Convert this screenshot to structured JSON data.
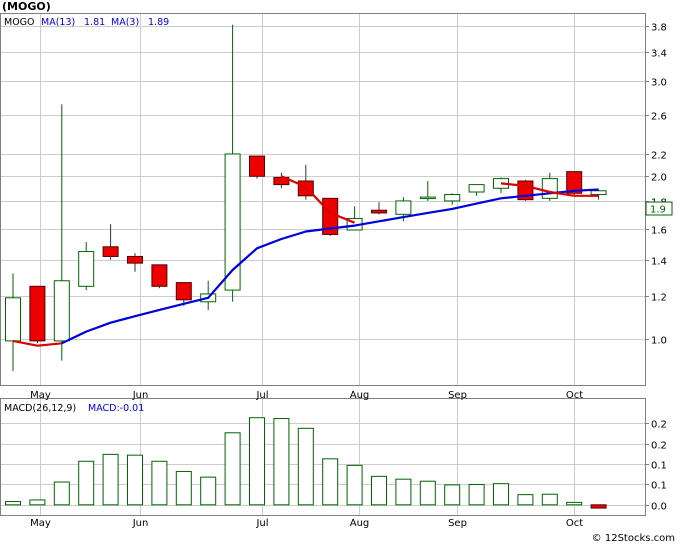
{
  "title": "(MOGO)",
  "legend": {
    "symbol": "MOGO",
    "ma13_label": "MA(13)",
    "ma13_value": "1.81",
    "ma3_label": "MA(3)",
    "ma3_value": "1.89"
  },
  "price_tag": "1.9",
  "macd_legend": {
    "label": "MACD(26,12,9)",
    "value_label": "MACD:-0.01"
  },
  "footer": "© 12Stocks.com",
  "colors": {
    "up_body": "#ffffff",
    "up_border": "#006400",
    "down_body": "#ee0000",
    "ma13": "#0000dd",
    "ma3": "#dd0000",
    "grid": "#cccccc",
    "frame": "#808080",
    "macd_bar": "#006400"
  },
  "chart_data": [
    {
      "type": "candlestick",
      "title": "(MOGO)",
      "scale": "log",
      "ylim": [
        0.82,
        4.0
      ],
      "yticks": [
        "1.0",
        "1.2",
        "1.4",
        "1.6",
        "1.8",
        "2.0",
        "2.2",
        "2.6",
        "3.0",
        "3.4",
        "3.8"
      ],
      "ytick_values": [
        1.0,
        1.2,
        1.4,
        1.6,
        1.8,
        2.0,
        2.2,
        2.6,
        3.0,
        3.4,
        3.8
      ],
      "x_labels": [
        {
          "label": "May",
          "index": 1.1
        },
        {
          "label": "Jun",
          "index": 5.2
        },
        {
          "label": "Jul",
          "index": 10.2
        },
        {
          "label": "Aug",
          "index": 14.2
        },
        {
          "label": "Sep",
          "index": 18.2
        },
        {
          "label": "Oct",
          "index": 23.0
        }
      ],
      "candles": [
        {
          "o": 0.99,
          "h": 1.32,
          "l": 0.87,
          "c": 1.19
        },
        {
          "o": 1.25,
          "h": 1.25,
          "l": 0.98,
          "c": 0.99
        },
        {
          "o": 0.99,
          "h": 2.72,
          "l": 0.91,
          "c": 1.28
        },
        {
          "o": 1.25,
          "h": 1.51,
          "l": 1.23,
          "c": 1.45
        },
        {
          "o": 1.48,
          "h": 1.63,
          "l": 1.4,
          "c": 1.42
        },
        {
          "o": 1.42,
          "h": 1.44,
          "l": 1.33,
          "c": 1.38
        },
        {
          "o": 1.37,
          "h": 1.37,
          "l": 1.24,
          "c": 1.25
        },
        {
          "o": 1.27,
          "h": 1.27,
          "l": 1.15,
          "c": 1.18
        },
        {
          "o": 1.17,
          "h": 1.28,
          "l": 1.13,
          "c": 1.21
        },
        {
          "o": 1.23,
          "h": 3.82,
          "l": 1.17,
          "c": 2.2
        },
        {
          "o": 2.18,
          "h": 2.18,
          "l": 1.98,
          "c": 2.0
        },
        {
          "o": 1.99,
          "h": 2.03,
          "l": 1.9,
          "c": 1.93
        },
        {
          "o": 1.96,
          "h": 2.1,
          "l": 1.81,
          "c": 1.84
        },
        {
          "o": 1.82,
          "h": 1.82,
          "l": 1.55,
          "c": 1.56
        },
        {
          "o": 1.59,
          "h": 1.76,
          "l": 1.59,
          "c": 1.67
        },
        {
          "o": 1.73,
          "h": 1.79,
          "l": 1.7,
          "c": 1.71
        },
        {
          "o": 1.7,
          "h": 1.83,
          "l": 1.65,
          "c": 1.8
        },
        {
          "o": 1.83,
          "h": 1.96,
          "l": 1.8,
          "c": 1.83
        },
        {
          "o": 1.8,
          "h": 1.86,
          "l": 1.77,
          "c": 1.85
        },
        {
          "o": 1.87,
          "h": 1.93,
          "l": 1.84,
          "c": 1.93
        },
        {
          "o": 1.9,
          "h": 1.99,
          "l": 1.86,
          "c": 1.98
        },
        {
          "o": 1.96,
          "h": 1.97,
          "l": 1.8,
          "c": 1.81
        },
        {
          "o": 1.82,
          "h": 2.03,
          "l": 1.8,
          "c": 1.98
        },
        {
          "o": 2.04,
          "h": 2.04,
          "l": 1.84,
          "c": 1.86
        },
        {
          "o": 1.85,
          "h": 1.89,
          "l": 1.81,
          "c": 1.88
        }
      ],
      "series": [
        {
          "label": "MA(13)",
          "values": [
            null,
            null,
            0.98,
            1.03,
            1.07,
            1.1,
            1.13,
            1.16,
            1.19,
            1.34,
            1.47,
            1.53,
            1.58,
            1.6,
            1.62,
            1.65,
            1.68,
            1.71,
            1.74,
            1.78,
            1.82,
            1.84,
            1.86,
            1.88,
            1.89
          ]
        },
        {
          "label": "MA(3)",
          "values": [
            0.99,
            0.97,
            0.98,
            null,
            null,
            null,
            null,
            null,
            null,
            null,
            null,
            2.0,
            1.91,
            1.71,
            1.64,
            null,
            null,
            null,
            null,
            null,
            1.94,
            1.92,
            1.87,
            1.84,
            1.84
          ]
        }
      ]
    },
    {
      "type": "bar",
      "title": "MACD(26,12,9)",
      "ylim": [
        -0.025,
        0.26
      ],
      "yticks": [
        "0.0",
        "0.1",
        "0.1",
        "0.2",
        "0.2"
      ],
      "ytick_values": [
        0.0,
        0.05,
        0.1,
        0.15,
        0.2
      ],
      "x_labels": [
        "May",
        "Jun",
        "Jul",
        "Aug",
        "Sep",
        "Oct"
      ],
      "values": [
        0.008,
        0.012,
        0.056,
        0.107,
        0.124,
        0.122,
        0.107,
        0.082,
        0.068,
        0.177,
        0.214,
        0.212,
        0.188,
        0.113,
        0.097,
        0.07,
        0.063,
        0.058,
        0.049,
        0.05,
        0.052,
        0.025,
        0.026,
        0.006,
        -0.008
      ]
    }
  ]
}
